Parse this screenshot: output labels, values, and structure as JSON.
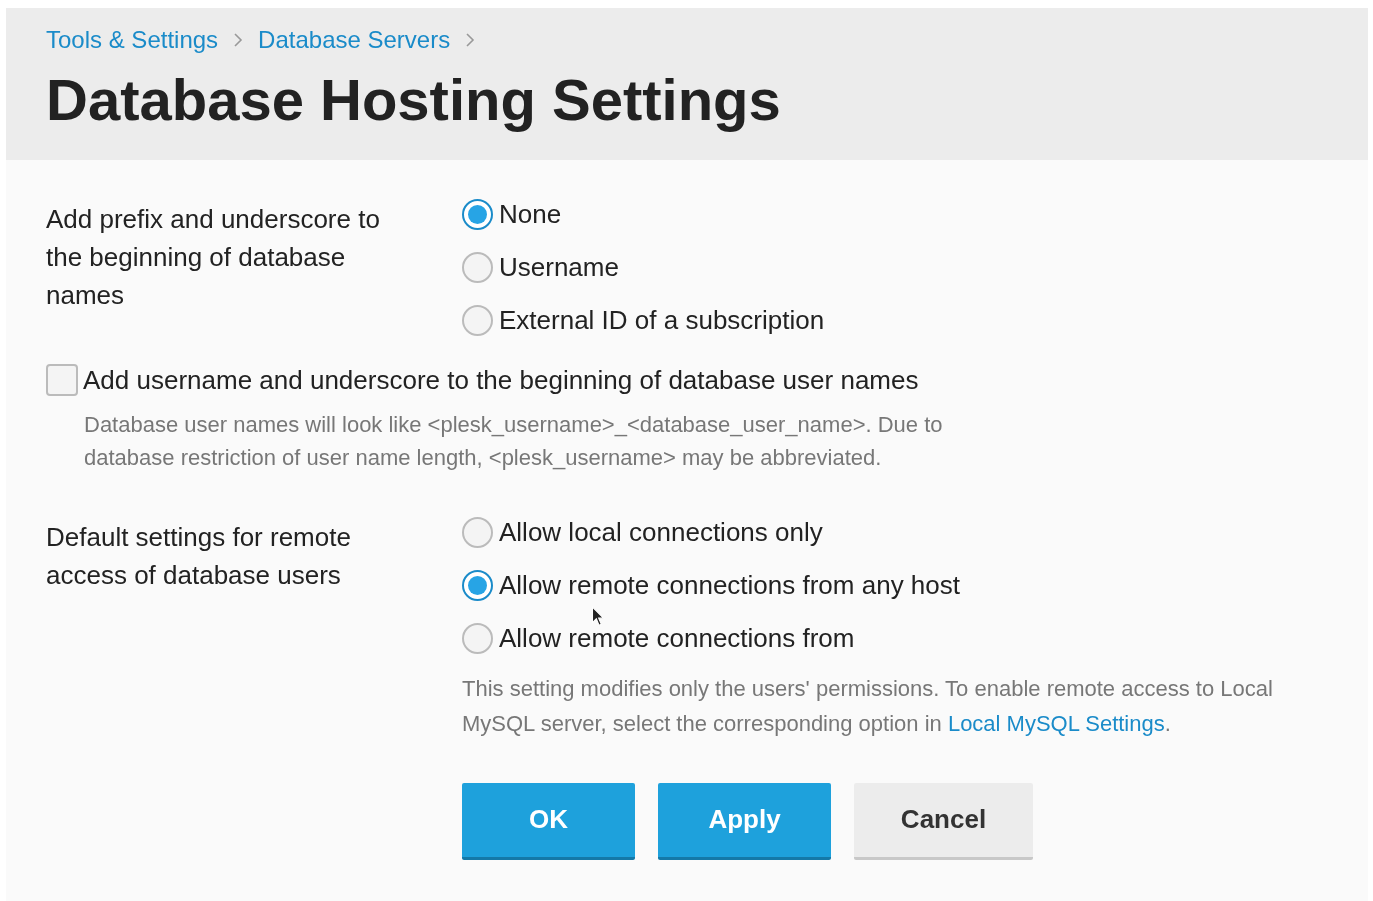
{
  "breadcrumbs": [
    {
      "label": "Tools & Settings"
    },
    {
      "label": "Database Servers"
    }
  ],
  "title": "Database Hosting Settings",
  "db_prefix": {
    "label": "Add prefix and underscore to the beginning of database names",
    "options": [
      {
        "label": "None",
        "selected": true
      },
      {
        "label": "Username",
        "selected": false
      },
      {
        "label": "External ID of a subscription",
        "selected": false
      }
    ]
  },
  "user_prefix": {
    "label": "Add username and underscore to the beginning of database user names",
    "checked": false,
    "hint": "Database user names will look like <plesk_username>_<database_user_name>. Due to database restriction of user name length, <plesk_username> may be abbreviated."
  },
  "remote_access": {
    "label": "Default settings for remote access of database users",
    "options": [
      {
        "label": "Allow local connections only",
        "selected": false
      },
      {
        "label": "Allow remote connections from any host",
        "selected": true
      },
      {
        "label": "Allow remote connections from",
        "selected": false
      }
    ],
    "hint": "This setting modifies only the users' permissions. To enable remote access to Local MySQL server, select the corresponding option in ",
    "hint_link": "Local MySQL Settings",
    "hint_end": "."
  },
  "buttons": [
    {
      "label": "OK",
      "kind": "primary"
    },
    {
      "label": "Apply",
      "kind": "primary"
    },
    {
      "label": "Cancel",
      "kind": "secondary"
    }
  ]
}
